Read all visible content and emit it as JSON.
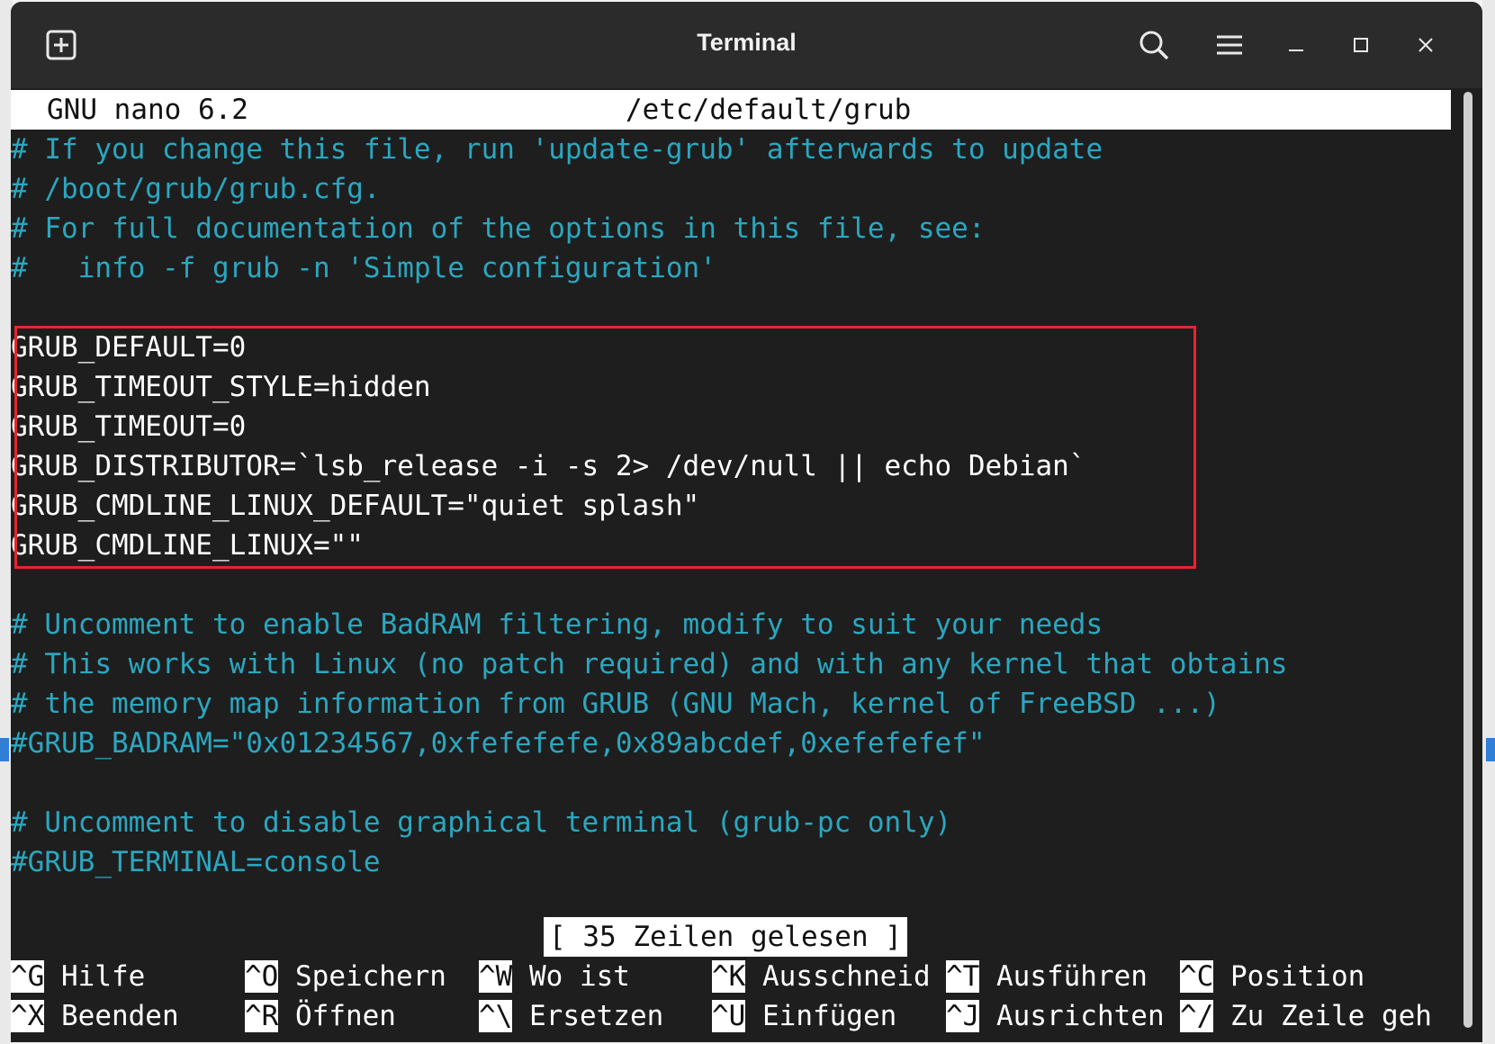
{
  "window": {
    "title": "Terminal",
    "icons": [
      "new-tab-icon",
      "search-icon",
      "menu-icon",
      "minimize-icon",
      "maximize-icon",
      "close-icon"
    ]
  },
  "nano": {
    "version": "GNU nano 6.2",
    "filename": "/etc/default/grub",
    "lines": [
      {
        "text": "# If you change this file, run 'update-grub' afterwards to update",
        "type": "comment"
      },
      {
        "text": "# /boot/grub/grub.cfg.",
        "type": "comment"
      },
      {
        "text": "# For full documentation of the options in this file, see:",
        "type": "comment"
      },
      {
        "text": "#   info -f grub -n 'Simple configuration'",
        "type": "comment"
      },
      {
        "text": "",
        "type": "normal"
      },
      {
        "text": "GRUB_DEFAULT=0",
        "type": "normal"
      },
      {
        "text": "GRUB_TIMEOUT_STYLE=hidden",
        "type": "normal"
      },
      {
        "text": "GRUB_TIMEOUT=0",
        "type": "normal"
      },
      {
        "text": "GRUB_DISTRIBUTOR=`lsb_release -i -s 2> /dev/null || echo Debian`",
        "type": "normal"
      },
      {
        "text": "GRUB_CMDLINE_LINUX_DEFAULT=\"quiet splash\"",
        "type": "normal"
      },
      {
        "text": "GRUB_CMDLINE_LINUX=\"\"",
        "type": "normal"
      },
      {
        "text": "",
        "type": "normal"
      },
      {
        "text": "# Uncomment to enable BadRAM filtering, modify to suit your needs",
        "type": "comment"
      },
      {
        "text": "# This works with Linux (no patch required) and with any kernel that obtains",
        "type": "comment"
      },
      {
        "text": "# the memory map information from GRUB (GNU Mach, kernel of FreeBSD ...)",
        "type": "comment"
      },
      {
        "text": "#GRUB_BADRAM=\"0x01234567,0xfefefefe,0x89abcdef,0xefefefef\"",
        "type": "comment"
      },
      {
        "text": "",
        "type": "normal"
      },
      {
        "text": "# Uncomment to disable graphical terminal (grub-pc only)",
        "type": "comment"
      },
      {
        "text": "#GRUB_TERMINAL=console",
        "type": "comment"
      }
    ],
    "status": "[ 35 Zeilen gelesen ]",
    "shortcuts_row1": [
      {
        "key": "^G",
        "label": " Hilfe"
      },
      {
        "key": "^O",
        "label": " Speichern"
      },
      {
        "key": "^W",
        "label": " Wo ist"
      },
      {
        "key": "^K",
        "label": " Ausschneid"
      },
      {
        "key": "^T",
        "label": " Ausführen"
      },
      {
        "key": "^C",
        "label": " Position"
      }
    ],
    "shortcuts_row2": [
      {
        "key": "^X",
        "label": " Beenden"
      },
      {
        "key": "^R",
        "label": " Öffnen"
      },
      {
        "key": "^\\",
        "label": " Ersetzen"
      },
      {
        "key": "^U",
        "label": " Einfügen"
      },
      {
        "key": "^J",
        "label": " Ausrichten"
      },
      {
        "key": "^/",
        "label": " Zu Zeile geh"
      }
    ]
  },
  "colors": {
    "comment": "#2aa7c0",
    "highlight_border": "#e5262e",
    "background": "#1e1e1e"
  }
}
